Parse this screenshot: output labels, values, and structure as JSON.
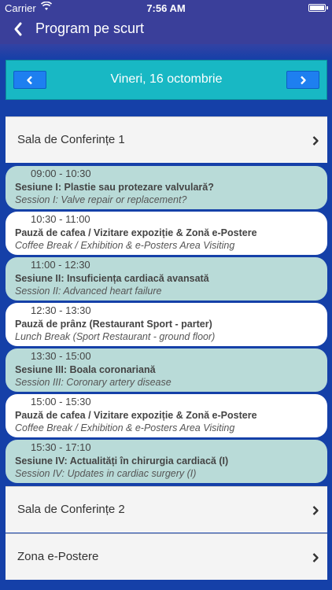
{
  "status_bar": {
    "carrier": "Carrier",
    "time": "7:56 AM"
  },
  "nav": {
    "title": "Program pe scurt",
    "back_icon": "chevron-left-icon"
  },
  "day_bar": {
    "date": "Vineri, 16 octombrie",
    "prev_icon": "chevron-left-icon",
    "next_icon": "chevron-right-icon"
  },
  "rooms": [
    {
      "label": "Sala de Conferințe 1"
    },
    {
      "label": "Sala de Conferințe 2"
    },
    {
      "label": "Zona e-Postere"
    }
  ],
  "sessions": [
    {
      "time": "09:00 - 10:30",
      "title": "Sesiune I: Plastie sau protezare valvulară?",
      "subtitle": "Session I: Valve repair or replacement?",
      "style": "teal"
    },
    {
      "time": "10:30 - 11:00",
      "title": "Pauză de cafea / Vizitare expoziție & Zonă e-Postere",
      "subtitle": "Coffee Break / Exhibition & e-Posters Area Visiting",
      "style": "white"
    },
    {
      "time": "11:00 - 12:30",
      "title": "Sesiune II: Insuficiența cardiacă avansată",
      "subtitle": "Session II: Advanced heart failure",
      "style": "teal"
    },
    {
      "time": "12:30 - 13:30",
      "title": "Pauză de prânz (Restaurant Sport - parter)",
      "subtitle": "Lunch Break (Sport Restaurant - ground floor)",
      "style": "white"
    },
    {
      "time": "13:30 - 15:00",
      "title": "Sesiune III: Boala coronariană",
      "subtitle": "Session III: Coronary artery disease",
      "style": "teal"
    },
    {
      "time": "15:00 - 15:30",
      "title": "Pauză de cafea / Vizitare expoziție & Zonă e-Postere",
      "subtitle": "Coffee Break / Exhibition & e-Posters Area Visiting",
      "style": "white"
    },
    {
      "time": "15:30 - 17:10",
      "title": "Sesiune IV: Actualități în chirurgia cardiacă (I)",
      "subtitle": "Session IV: Updates in cardiac surgery (I)",
      "style": "teal"
    }
  ],
  "colors": {
    "background": "#1540a8",
    "nav": "#3a3f9a",
    "day_bar": "#18b8c4",
    "nav_button": "#1e7ff0",
    "session_teal": "#b9dbd8",
    "session_white": "#ffffff"
  }
}
